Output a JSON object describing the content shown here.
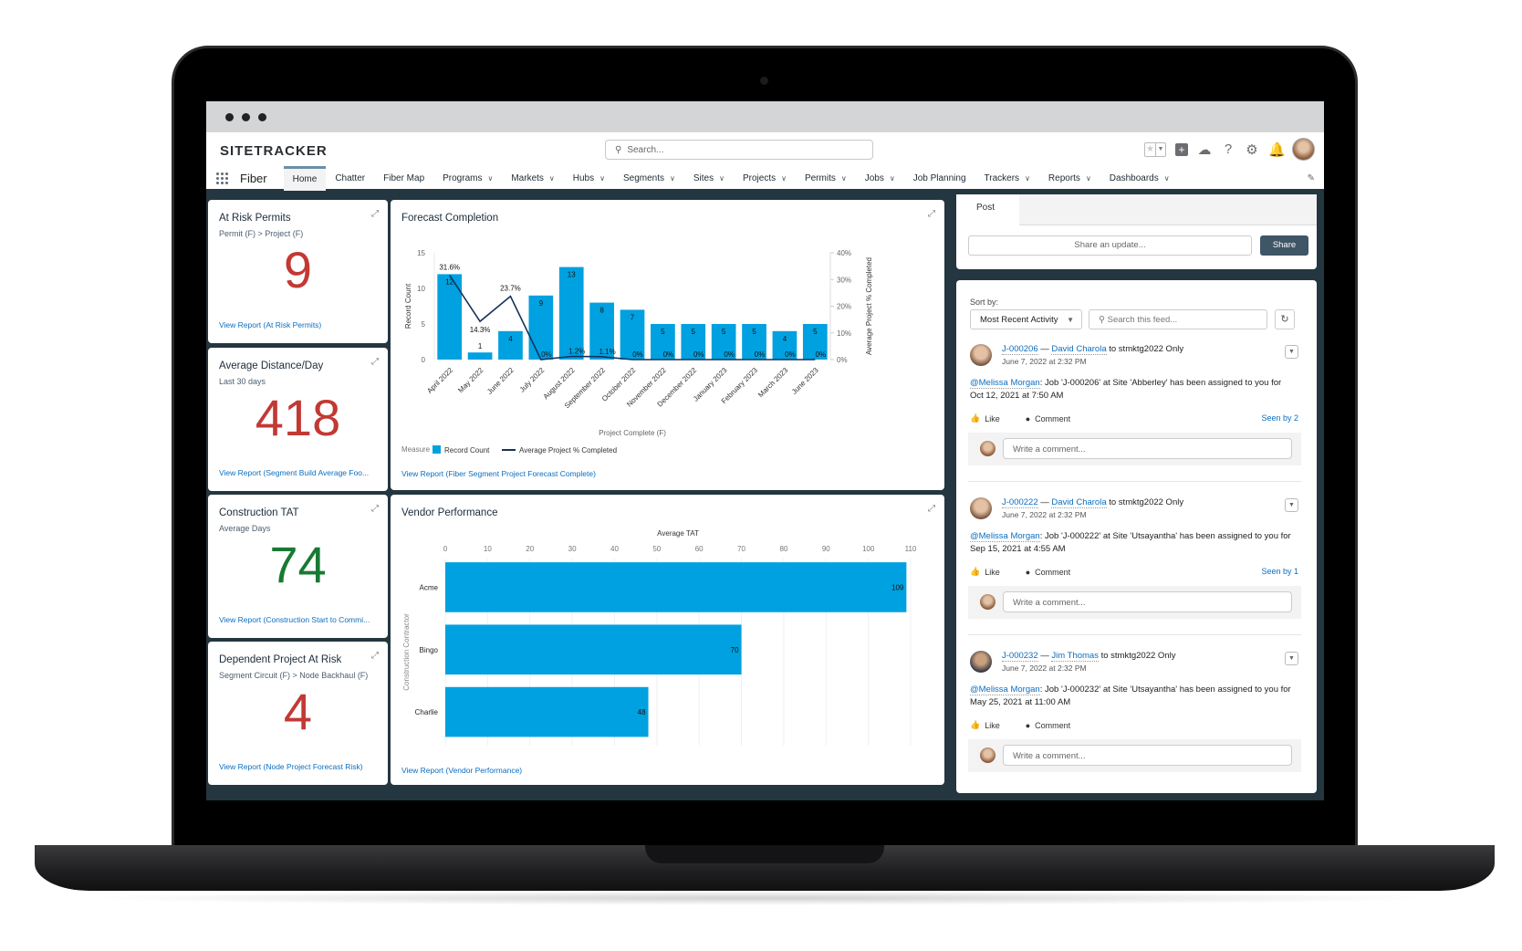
{
  "window": {
    "title_dots": 3
  },
  "header": {
    "logo": "SITETRACKER",
    "search_placeholder": "Search...",
    "icons": [
      "favorites-star-icon",
      "add-icon",
      "trailhead-icon",
      "help-icon",
      "settings-icon",
      "notifications-bell-icon",
      "user-avatar"
    ]
  },
  "nav": {
    "app_name": "Fiber",
    "items": [
      {
        "label": "Home",
        "dropdown": false,
        "active": true
      },
      {
        "label": "Chatter",
        "dropdown": false
      },
      {
        "label": "Fiber Map",
        "dropdown": false
      },
      {
        "label": "Programs",
        "dropdown": true
      },
      {
        "label": "Markets",
        "dropdown": true
      },
      {
        "label": "Hubs",
        "dropdown": true
      },
      {
        "label": "Segments",
        "dropdown": true
      },
      {
        "label": "Sites",
        "dropdown": true
      },
      {
        "label": "Projects",
        "dropdown": true
      },
      {
        "label": "Permits",
        "dropdown": true
      },
      {
        "label": "Jobs",
        "dropdown": true
      },
      {
        "label": "Job Planning",
        "dropdown": false
      },
      {
        "label": "Trackers",
        "dropdown": true
      },
      {
        "label": "Reports",
        "dropdown": true
      },
      {
        "label": "Dashboards",
        "dropdown": true
      }
    ]
  },
  "metrics": [
    {
      "title": "At Risk Permits",
      "subtitle": "Permit (F) > Project (F)",
      "value": "9",
      "color": "#c23934",
      "link": "View Report (At Risk Permits)"
    },
    {
      "title": "Average Distance/Day",
      "subtitle": "Last 30 days",
      "value": "418",
      "color": "#c23934",
      "link": "View Report (Segment Build Average Foo..."
    },
    {
      "title": "Construction TAT",
      "subtitle": "Average Days",
      "value": "74",
      "color": "#187a32",
      "link": "View Report (Construction Start to Commi..."
    },
    {
      "title": "Dependent Project At Risk",
      "subtitle": "Segment Circuit (F) > Node Backhaul (F)",
      "value": "4",
      "color": "#c23934",
      "link": "View Report (Node Project Forecast Risk)"
    }
  ],
  "forecast": {
    "title": "Forecast Completion",
    "link": "View Report (Fiber Segment Project Forecast Complete)",
    "legend_label": "Measure"
  },
  "vendor": {
    "title": "Vendor Performance",
    "link": "View Report (Vendor Performance)"
  },
  "chart_data": [
    {
      "type": "bar",
      "title": "Forecast Completion",
      "xlabel": "Project Complete (F)",
      "ylabel": "Record Count",
      "y2label": "Average Project % Completed",
      "ylim": [
        0,
        15
      ],
      "yticks": [
        0,
        5,
        10,
        15
      ],
      "y2lim": [
        0,
        40
      ],
      "y2ticks": [
        "0%",
        "10%",
        "20%",
        "30%",
        "40%"
      ],
      "categories": [
        "April 2022",
        "May 2022",
        "June 2022",
        "July 2022",
        "August 2022",
        "September 2022",
        "October 2022",
        "November 2022",
        "December 2022",
        "January 2023",
        "February 2023",
        "March 2023",
        "June 2023"
      ],
      "series": [
        {
          "name": "Record Count",
          "kind": "bar",
          "color": "#00a1e0",
          "values": [
            12,
            1,
            4,
            9,
            13,
            8,
            7,
            5,
            5,
            5,
            5,
            4,
            5
          ]
        },
        {
          "name": "Average Project % Completed",
          "kind": "line",
          "color": "#16325c",
          "values": [
            31.6,
            14.3,
            23.7,
            0,
            1.2,
            1.1,
            0,
            0,
            0,
            0,
            0,
            0,
            0
          ],
          "labels": [
            "31.6%",
            "14.3%",
            "23.7%",
            "0%",
            "1.2%",
            "1.1%",
            "0%",
            "0%",
            "0%",
            "0%",
            "0%",
            "0%",
            "0%"
          ]
        }
      ],
      "legend": "bottom-left"
    },
    {
      "type": "bar",
      "orientation": "horizontal",
      "title": "Vendor Performance",
      "xlabel": "Average TAT",
      "ylabel": "Construction Contractor",
      "xlim": [
        0,
        110
      ],
      "xticks": [
        0,
        10,
        20,
        30,
        40,
        50,
        60,
        70,
        80,
        90,
        100,
        110
      ],
      "categories": [
        "Acme",
        "Bingo",
        "Charlie"
      ],
      "values": [
        109,
        70,
        48
      ],
      "color": "#00a1e0"
    }
  ],
  "feed": {
    "post_tab": "Post",
    "share_placeholder": "Share an update...",
    "share_button": "Share",
    "sort_label": "Sort by:",
    "sort_value": "Most Recent Activity",
    "search_placeholder": "Search this feed...",
    "like_label": "Like",
    "comment_label": "Comment",
    "comment_placeholder": "Write a comment...",
    "posts": [
      {
        "job": "J-000206",
        "author": "David Charola",
        "audience": "to stmktg2022 Only",
        "date": "June 7, 2022 at 2:32 PM",
        "mention": "@Melissa Morgan",
        "body": ": Job 'J-000206' at Site 'Abberley' has been assigned to you for Oct 12, 2021 at 7:50 AM",
        "seen": "Seen by 2"
      },
      {
        "job": "J-000222",
        "author": "David Charola",
        "audience": "to stmktg2022 Only",
        "date": "June 7, 2022 at 2:32 PM",
        "mention": "@Melissa Morgan",
        "body": ": Job 'J-000222' at Site 'Utsayantha' has been assigned to you for Sep 15, 2021 at 4:55 AM",
        "seen": "Seen by 1"
      },
      {
        "job": "J-000232",
        "author": "Jim Thomas",
        "audience": "to stmktg2022 Only",
        "date": "June 7, 2022 at 2:32 PM",
        "mention": "@Melissa Morgan",
        "body": ": Job 'J-000232' at Site 'Utsayantha' has been assigned to you for May 25, 2021 at 11:00 AM",
        "seen": ""
      }
    ]
  }
}
